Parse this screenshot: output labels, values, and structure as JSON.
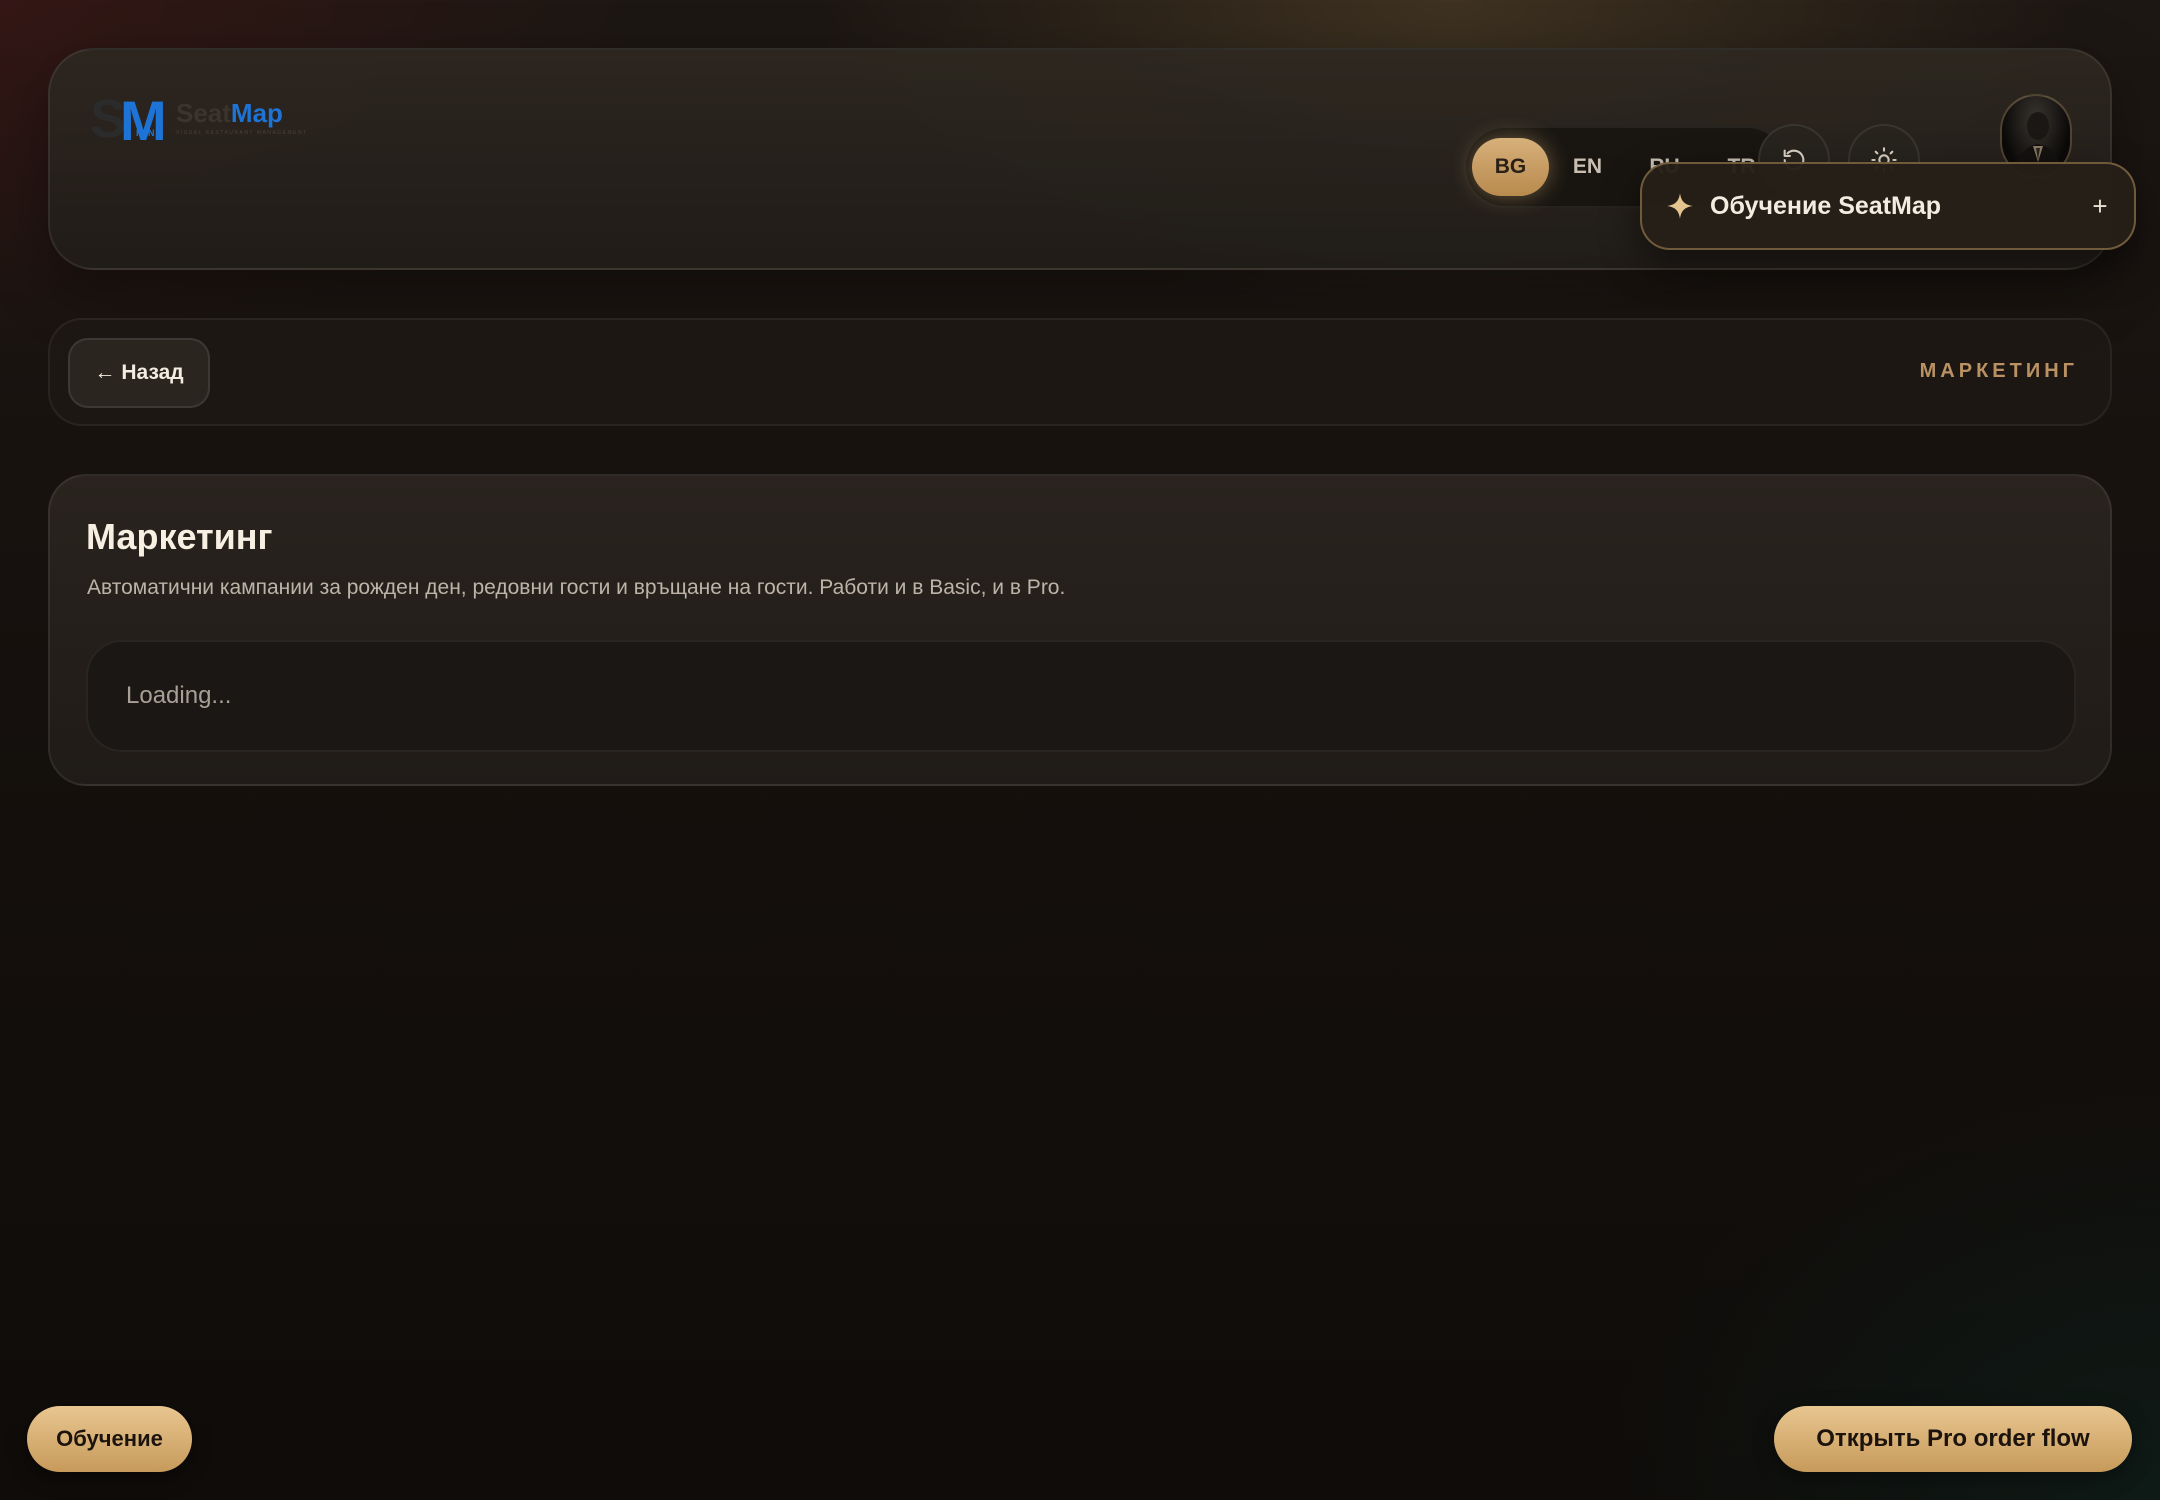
{
  "header": {
    "logo": {
      "mark_letters": "SM",
      "mark_sub": "KTN",
      "word_seat": "Seat",
      "word_map": "Map",
      "tagline": "Visual Restaurant Management"
    },
    "languages": [
      {
        "label": "BG",
        "active": true
      },
      {
        "label": "EN",
        "active": false
      },
      {
        "label": "RU",
        "active": false
      },
      {
        "label": "TR",
        "active": false
      }
    ],
    "icons": {
      "refresh": "refresh-icon",
      "theme": "sun-icon",
      "avatar": "user-avatar"
    }
  },
  "tutorial_popover": {
    "title": "Обучение SeatMap",
    "expand_symbol": "+",
    "icon": "sparkle-icon"
  },
  "nav": {
    "back_label": "Назад",
    "back_icon": "arrow-left-icon",
    "section_label": "МАРКЕТИНГ"
  },
  "main": {
    "title": "Маркетинг",
    "description": "Автоматични кампании за рожден ден, редовни гости и връщане на гости. Работи и в Basic, и в Pro.",
    "loading_text": "Loading..."
  },
  "footer": {
    "tutorial_button": "Обучение",
    "pro_button": "Открыть Pro order flow"
  },
  "colors": {
    "accent_gold": "#d7b07a",
    "accent_blue": "#1d74d6",
    "section_label": "#b99163"
  }
}
